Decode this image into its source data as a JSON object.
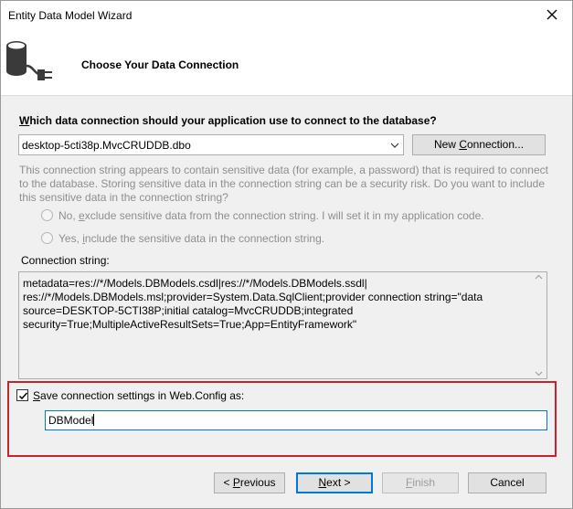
{
  "window": {
    "title": "Entity Data Model Wizard"
  },
  "header": {
    "title": "Choose Your Data Connection",
    "icon": "database-plug-icon"
  },
  "question": {
    "prefix": "",
    "accel": "W",
    "rest": "hich data connection should your application use to connect to the database?"
  },
  "connection_combo": {
    "value": "desktop-5cti38p.MvcCRUDDB.dbo"
  },
  "new_connection_button": {
    "prefix": "New ",
    "accel": "C",
    "rest": "onnection..."
  },
  "sensitive_note": "This connection string appears to contain sensitive data (for example, a password) that is required to connect to the database. Storing sensitive data in the connection string can be a security risk. Do you want to include this sensitive data in the connection string?",
  "radio_no": {
    "prefix": "No, ",
    "accel": "e",
    "rest": "xclude sensitive data from the connection string. I will set it in my application code."
  },
  "radio_yes": {
    "prefix": "Yes, ",
    "accel": "i",
    "rest": "nclude the sensitive data in the connection string."
  },
  "connection_string": {
    "label": "Connection string:",
    "value": "metadata=res://*/Models.DBModels.csdl|res://*/Models.DBModels.ssdl|\nres://*/Models.DBModels.msl;provider=System.Data.SqlClient;provider connection string=\"data\nsource=DESKTOP-5CTI38P;initial catalog=MvcCRUDDB;integrated\nsecurity=True;MultipleActiveResultSets=True;App=EntityFramework\""
  },
  "save_settings": {
    "checked": true,
    "accel": "S",
    "rest": "ave connection settings in Web.Config as:"
  },
  "model_name": {
    "value": "DBModel"
  },
  "buttons": {
    "previous": {
      "prefix": "< ",
      "accel": "P",
      "rest": "revious"
    },
    "next": {
      "accel": "N",
      "rest": "ext >"
    },
    "finish": {
      "accel": "F",
      "rest": "inish"
    },
    "cancel": "Cancel"
  },
  "colors": {
    "highlight_border": "#c8232c",
    "focus_blue": "#0078d7"
  }
}
